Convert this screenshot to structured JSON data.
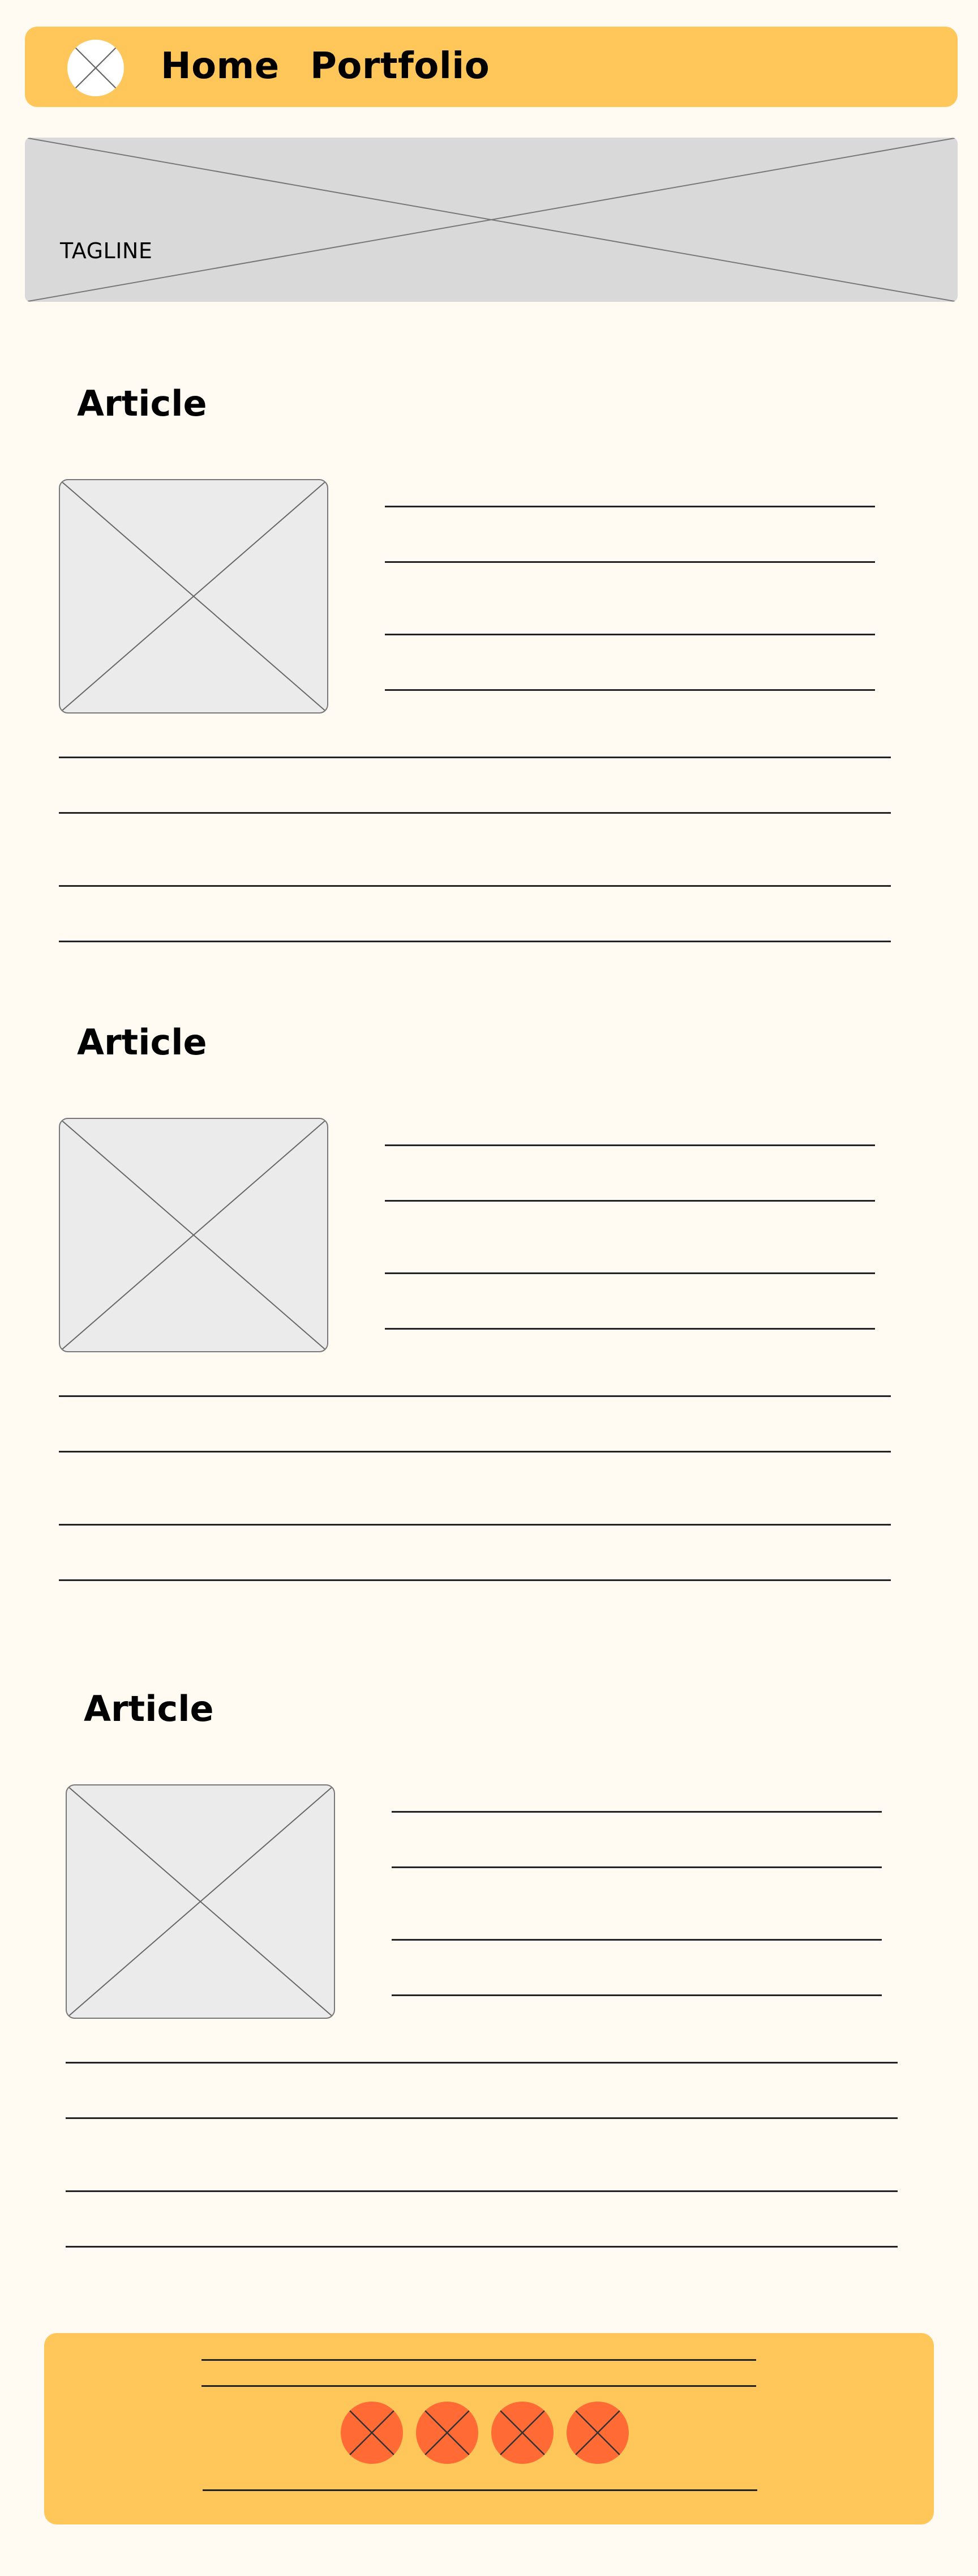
{
  "header": {
    "logo_icon": "logo-placeholder-icon",
    "nav": [
      {
        "label": "Home"
      },
      {
        "label": "Portfolio"
      }
    ],
    "background": "#ffc65a"
  },
  "hero": {
    "tagline": "TAGLINE",
    "background": "#d9d9d9"
  },
  "articles": [
    {
      "title": "Article"
    },
    {
      "title": "Article"
    },
    {
      "title": "Article"
    }
  ],
  "footer": {
    "background": "#ffc65a",
    "social_icons": [
      "social-icon",
      "social-icon",
      "social-icon",
      "social-icon"
    ],
    "social_color": "#ff6a35"
  },
  "page_background": "#fffbf3"
}
